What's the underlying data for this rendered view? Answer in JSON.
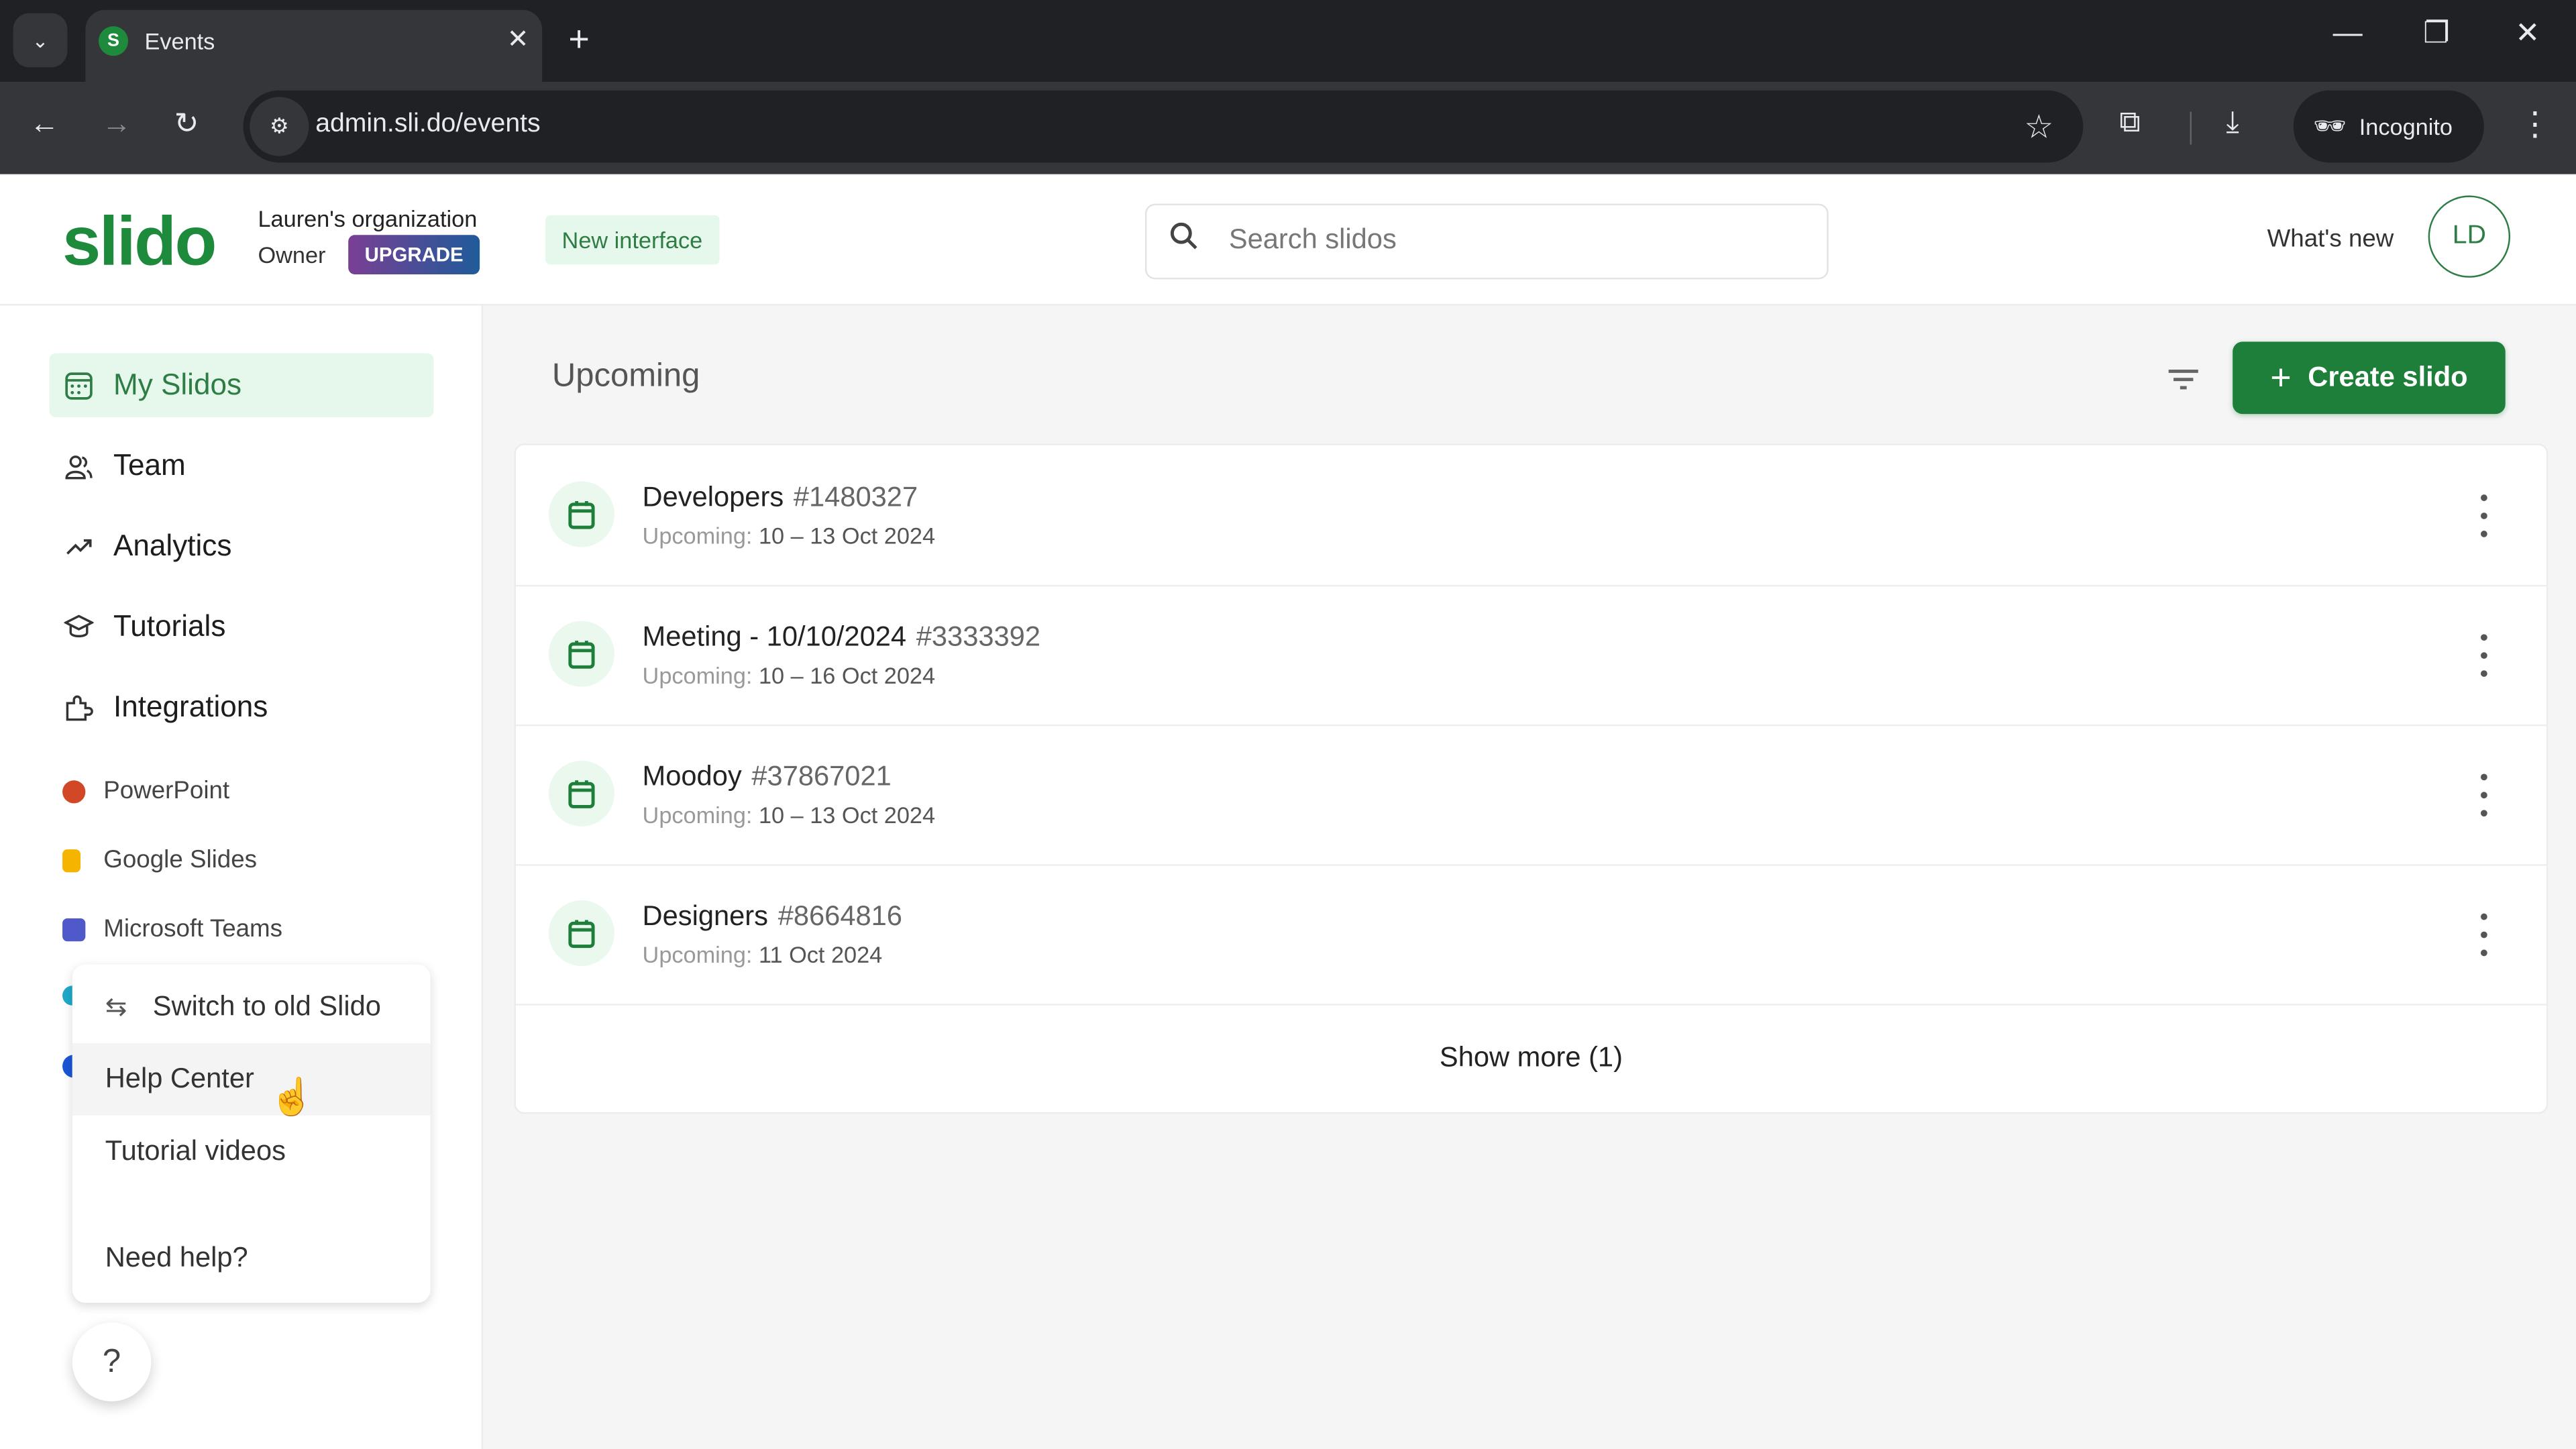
{
  "browser": {
    "tab_title": "Events",
    "tab_favicon_letter": "S",
    "url": "admin.sli.do/events",
    "incognito_label": "Incognito",
    "icons": {
      "tab_list": "⌄",
      "tab_close": "✕",
      "new_tab": "+",
      "minimize": "—",
      "restore": "❐",
      "close": "✕",
      "back": "←",
      "forward": "→",
      "reload": "↻",
      "site_info": "⚙",
      "bookmark": "☆",
      "extensions": "⧉",
      "download": "⤓",
      "incognito": "🕶",
      "menu": "⋮"
    }
  },
  "header": {
    "logo": "slido",
    "org_name": "Lauren's organization",
    "role": "Owner",
    "upgrade_label": "UPGRADE",
    "new_interface_label": "New interface",
    "search_placeholder": "Search slidos",
    "search_value": "",
    "whats_new": "What's new",
    "avatar_initials": "LD",
    "brand_color": "#1e8a3c"
  },
  "sidebar": {
    "nav": [
      {
        "label": "My Slidos",
        "icon": "calendar-grid-icon",
        "active": true
      },
      {
        "label": "Team",
        "icon": "team-icon",
        "active": false
      },
      {
        "label": "Analytics",
        "icon": "trend-icon",
        "active": false
      },
      {
        "label": "Tutorials",
        "icon": "graduation-cap-icon",
        "active": false
      },
      {
        "label": "Integrations",
        "icon": "puzzle-icon",
        "active": false
      }
    ],
    "integrations": [
      {
        "label": "PowerPoint",
        "color": "#d24726"
      },
      {
        "label": "Google Slides",
        "color": "#f4b400"
      },
      {
        "label": "Microsoft Teams",
        "color": "#5059c9"
      }
    ],
    "help_menu": {
      "items": [
        {
          "label": "Switch to old Slido",
          "icon": "⇆"
        },
        {
          "label": "Help Center",
          "hovered": true
        },
        {
          "label": "Tutorial videos"
        },
        {
          "label": "Need help?"
        }
      ]
    },
    "help_button": "?"
  },
  "main": {
    "section_title": "Upcoming",
    "create_button": "Create slido",
    "events": [
      {
        "name": "Developers",
        "code": "#1480327",
        "status": "Upcoming:",
        "date": "10 – 13 Oct 2024"
      },
      {
        "name": "Meeting - 10/10/2024",
        "code": "#3333392",
        "status": "Upcoming:",
        "date": "10 – 16 Oct 2024"
      },
      {
        "name": "Moodoy",
        "code": "#37867021",
        "status": "Upcoming:",
        "date": "10 – 13 Oct 2024"
      },
      {
        "name": "Designers",
        "code": "#8664816",
        "status": "Upcoming:",
        "date": "11 Oct 2024"
      }
    ],
    "show_more": "Show more (1)"
  }
}
